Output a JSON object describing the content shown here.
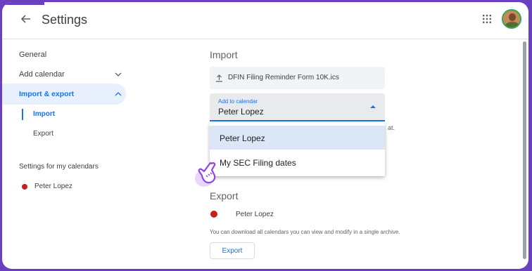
{
  "header": {
    "title": "Settings",
    "back_icon": "arrow-left-icon",
    "apps_icon": "apps-grid-icon",
    "avatar_icon": "user-avatar"
  },
  "sidebar": {
    "general": "General",
    "add_calendar": "Add calendar",
    "import_export": "Import & export",
    "import": "Import",
    "export": "Export",
    "my_calendars_heading": "Settings for my calendars",
    "calendar_name": "Peter Lopez"
  },
  "import": {
    "heading": "Import",
    "file_name": "DFIN Filing Reminder Form 10K.ics",
    "add_to_label": "Add to calendar",
    "selected_value": "Peter Lopez",
    "partial_text": "at.",
    "options": [
      "Peter Lopez",
      "My SEC Filing dates"
    ]
  },
  "export": {
    "heading": "Export",
    "calendar_name": "Peter Lopez",
    "note": "You can download all calendars you can view and modify in a single archive.",
    "button_label": "Export"
  },
  "colors": {
    "accent": "#1a73e8",
    "active_bg": "#e8f0fe",
    "calendar_dot": "#c5221f",
    "frame": "#6a3fc0",
    "cursor": "#8e44ec"
  }
}
